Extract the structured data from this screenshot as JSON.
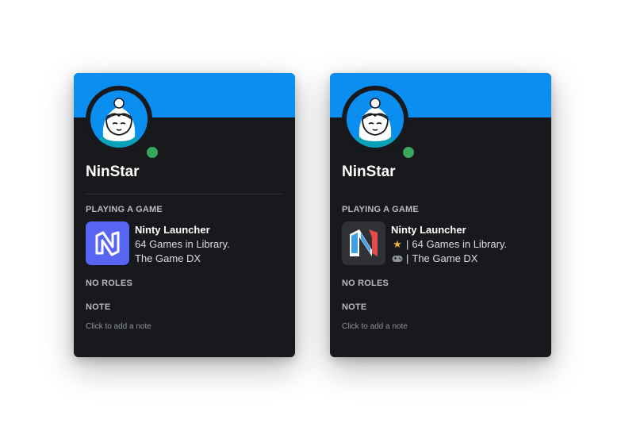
{
  "cards": [
    {
      "username": "NinStar",
      "playing_heading": "PLAYING A GAME",
      "game_title": "Ninty Launcher",
      "game_line1": "64 Games in Library.",
      "game_line2": "The Game DX",
      "roles_heading": "NO ROLES",
      "note_heading": "NOTE",
      "note_placeholder": "Click to add a note"
    },
    {
      "username": "NinStar",
      "playing_heading": "PLAYING A GAME",
      "game_title": "Ninty Launcher",
      "game_line1_icon": "★",
      "game_line1": "64 Games in Library.",
      "game_line2_icon": "🎮",
      "game_line2": "The Game DX",
      "separator": "|",
      "roles_heading": "NO ROLES",
      "note_heading": "NOTE",
      "note_placeholder": "Click to add a note"
    }
  ],
  "colors": {
    "banner": "#0a8ef0",
    "card_bg": "#18191c",
    "status_online": "#3ba55d",
    "game_icon_left": "#5865f2",
    "game_icon_right": "#2f3136",
    "star": "#f0b232"
  },
  "icons": {
    "avatar": "princess-avatar-icon",
    "status": "online-status-icon",
    "game_left": "ninty-launcher-logo-icon",
    "game_right": "ninty-launcher-logo-red-icon",
    "star": "star-icon",
    "controller": "controller-icon"
  }
}
